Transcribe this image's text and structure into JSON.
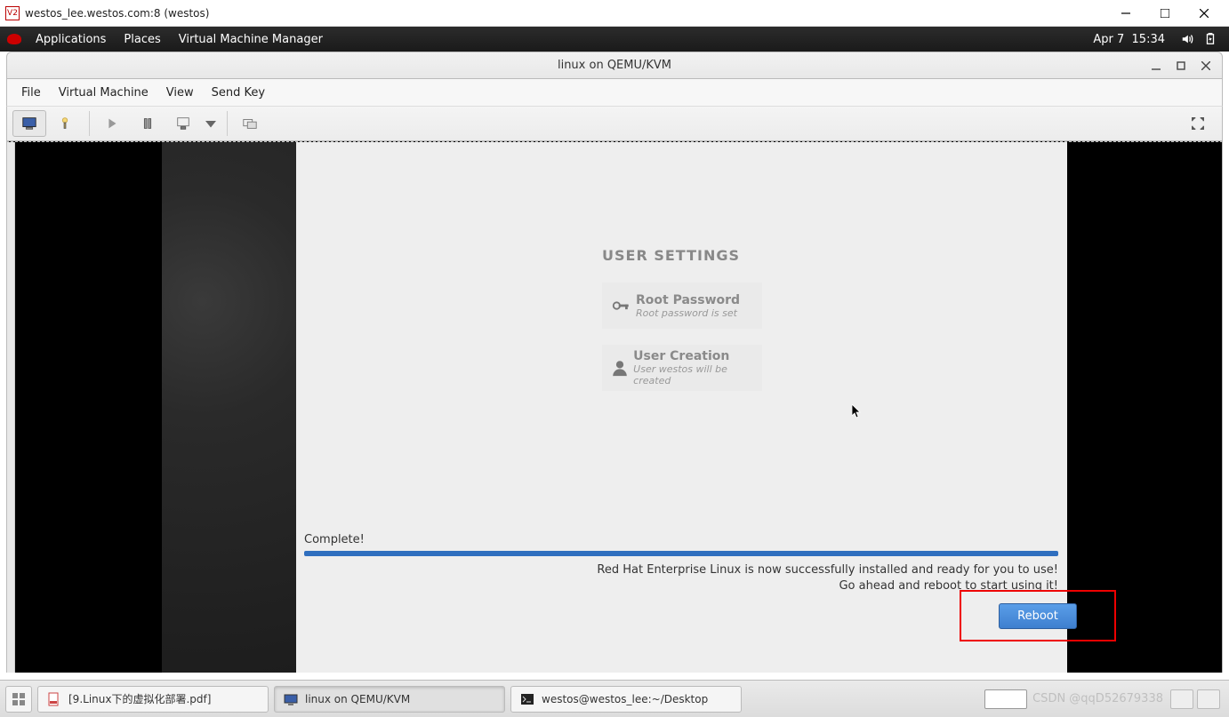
{
  "vnc": {
    "icon_text": "V2",
    "title": "westos_lee.westos.com:8 (westos)"
  },
  "gnome": {
    "menu": [
      "Applications",
      "Places",
      "Virtual Machine Manager"
    ],
    "date": "Apr 7",
    "time": "15:34"
  },
  "vmm": {
    "title": "linux on QEMU/KVM",
    "menu": [
      "File",
      "Virtual Machine",
      "View",
      "Send Key"
    ]
  },
  "anaconda": {
    "heading": "USER SETTINGS",
    "spokes": [
      {
        "title": "Root Password",
        "sub": "Root password is set"
      },
      {
        "title": "User Creation",
        "sub": "User westos will be created"
      }
    ],
    "progress_label": "Complete!",
    "msg1": "Red Hat Enterprise Linux is now successfully installed and ready for you to use!",
    "msg2": "Go ahead and reboot to start using it!",
    "reboot": "Reboot"
  },
  "taskbar": {
    "items": [
      {
        "label": "[9.Linux下的虚拟化部署.pdf]"
      },
      {
        "label": "linux on QEMU/KVM"
      },
      {
        "label": "westos@westos_lee:~/Desktop"
      }
    ],
    "watermark": "CSDN @qqD52679338"
  }
}
